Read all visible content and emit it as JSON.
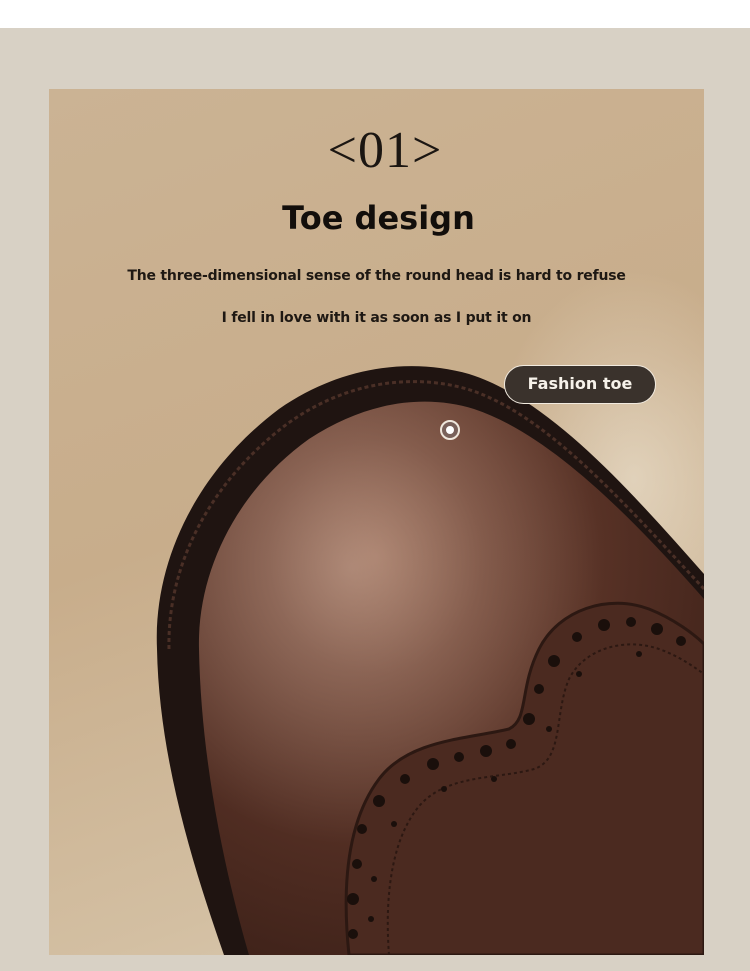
{
  "section": {
    "number": "<01>",
    "title": "Toe design",
    "description_lines": [
      "The three-dimensional sense of the round head is hard to refuse",
      "I fell in love with it as soon as I put it on"
    ]
  },
  "hotspot": {
    "label": "Fashion toe"
  },
  "colors": {
    "frame": "#d8d1c5",
    "panel_background": "#c8ad8b",
    "leather": "#5a3428",
    "badge_background": "#3a322c",
    "text": "#120e0b"
  }
}
